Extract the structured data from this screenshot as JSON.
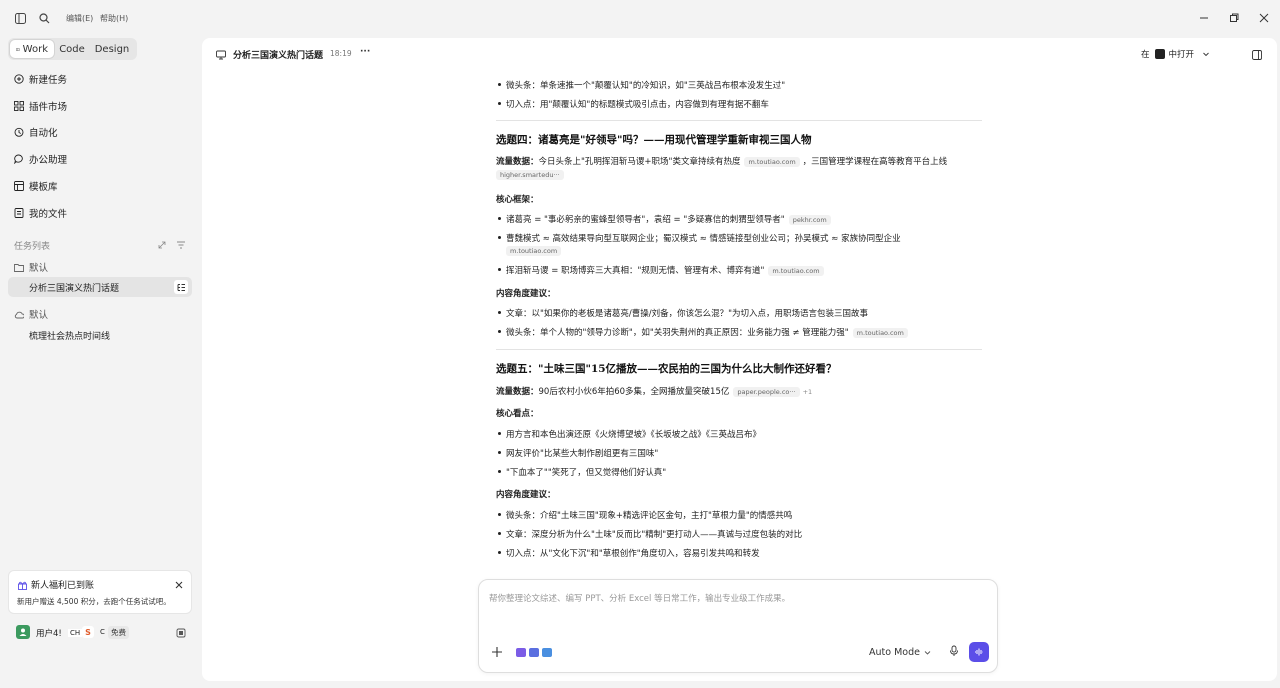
{
  "titlebar": {
    "menu_edit": "编辑(E)",
    "menu_help": "帮助(H)"
  },
  "sidebar": {
    "modes": [
      "Work",
      "Code",
      "Design"
    ],
    "nav": [
      "新建任务",
      "插件市场",
      "自动化",
      "办公助理",
      "模板库",
      "我的文件"
    ],
    "tasks_title": "任务列表",
    "groups": [
      {
        "name": "默认",
        "items": [
          "分析三国演义热门话题"
        ]
      },
      {
        "name": "默认",
        "items": [
          "梳理社会热点时间线"
        ]
      }
    ],
    "promo": {
      "title": "新人福利已到账",
      "text": "新用户赠送 4,500 积分，去跑个任务试试吧。"
    },
    "user": {
      "name": "用户4!",
      "extra1": "CH",
      "extra2": "C",
      "badge": "免费"
    }
  },
  "header": {
    "title": "分析三国演义热门话题",
    "time": "18:19",
    "more": "···",
    "open_in_prefix": "在",
    "open_in_label": "中打开"
  },
  "article": {
    "top_bullets": [
      "微头条：单条速推一个\"颠覆认知\"的冷知识，如\"三英战吕布根本没发生过\"",
      "切入点：用\"颠覆认知\"的标题模式吸引点击，内容做到有理有据不翻车"
    ],
    "topic4": {
      "title": "选题四：诸葛亮是\"好领导\"吗？——用现代管理学重新审视三国人物",
      "traffic_label": "流量数据：",
      "traffic_text": "今日头条上\"孔明挥泪斩马谡+职场\"类文章持续有热度",
      "traffic_src1": "m.toutiao.com",
      "traffic_text2": "，三国管理学课程在高等教育平台上线",
      "traffic_src2": "higher.smartedu···",
      "framework_label": "核心框架：",
      "framework": [
        {
          "text": "诸葛亮 = \"事必躬亲的蜜蜂型领导者\"，袁绍 = \"多疑寡信的刺猬型领导者\"",
          "src": "pekhr.com"
        },
        {
          "text": "曹魏模式 ≈ 高效结果导向型互联网企业；蜀汉模式 ≈ 情感链接型创业公司；孙吴模式 ≈ 家族协同型企业",
          "src": "m.toutiao.com"
        },
        {
          "text": "挥泪斩马谡 = 职场博弈三大真相：\"规则无情、管理有术、博弈有道\"",
          "src": "m.toutiao.com"
        }
      ],
      "angle_label": "内容角度建议：",
      "angles": [
        {
          "text": "文章：以\"如果你的老板是诸葛亮/曹操/刘备，你该怎么混？\"为切入点，用职场语言包装三国故事",
          "src": ""
        },
        {
          "text": "微头条：单个人物的\"领导力诊断\"，如\"关羽失荆州的真正原因：业务能力强 ≠ 管理能力强\"",
          "src": "m.toutiao.com"
        }
      ]
    },
    "topic5": {
      "title": "选题五：\"土味三国\"15亿播放——农民拍的三国为什么比大制作还好看？",
      "traffic_label": "流量数据：",
      "traffic_text": "90后农村小伙6年拍60多集，全网播放量突破15亿",
      "traffic_src": "paper.people.co···",
      "traffic_more": "+1",
      "points_label": "核心看点：",
      "points": [
        "用方言和本色出演还原《火烧博望坡》《长坂坡之战》《三英战吕布》",
        "网友评价\"比某些大制作剧组更有三国味\"",
        "\"下血本了\"\"笑死了，但又觉得他们好认真\""
      ],
      "angle_label": "内容角度建议：",
      "angles": [
        "微头条：介绍\"土味三国\"现象+精选评论区金句，主打\"草根力量\"的情感共鸣",
        "文章：深度分析为什么\"土味\"反而比\"精制\"更打动人——真诚与过度包装的对比",
        "切入点：从\"文化下沉\"和\"草根创作\"角度切入，容易引发共鸣和转发"
      ]
    }
  },
  "composer": {
    "placeholder": "帮你整理论文综述、编写 PPT、分析 Excel 等日常工作，输出专业级工作成果。",
    "mode": "Auto Mode"
  },
  "colors": {
    "accent": "#5b4ee8",
    "bg": "#f3f3f3",
    "panel": "#ffffff"
  }
}
